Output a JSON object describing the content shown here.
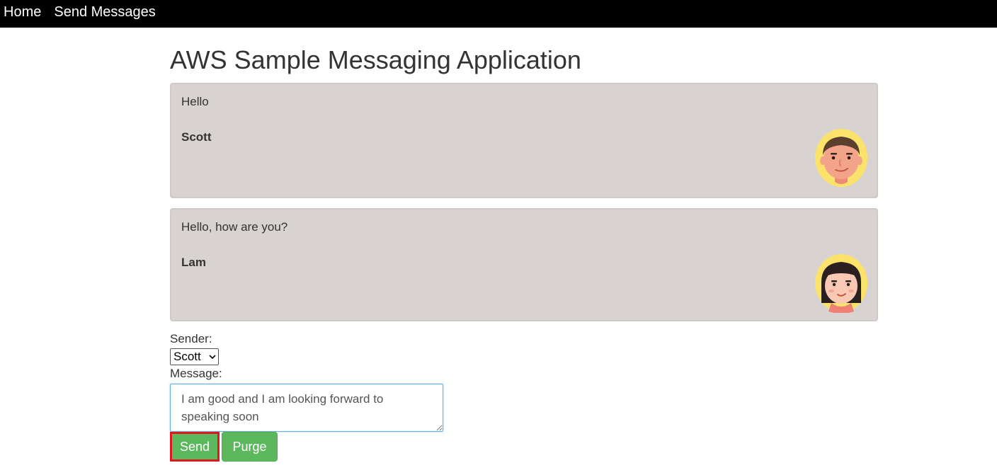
{
  "nav": {
    "home_label": "Home",
    "send_messages_label": "Send Messages"
  },
  "page_title": "AWS Sample Messaging Application",
  "messages": [
    {
      "text": "Hello",
      "sender": "Scott"
    },
    {
      "text": "Hello, how are you?",
      "sender": "Lam"
    }
  ],
  "form": {
    "sender_label": "Sender:",
    "sender_selected": "Scott",
    "message_label": "Message:",
    "message_value": "I am good and I am looking forward to speaking soon",
    "send_label": "Send",
    "purge_label": "Purge"
  },
  "colors": {
    "nav_bg": "#000000",
    "card_bg": "#d8d3d0",
    "button_bg": "#5cb85c",
    "highlight": "#e0191f"
  }
}
